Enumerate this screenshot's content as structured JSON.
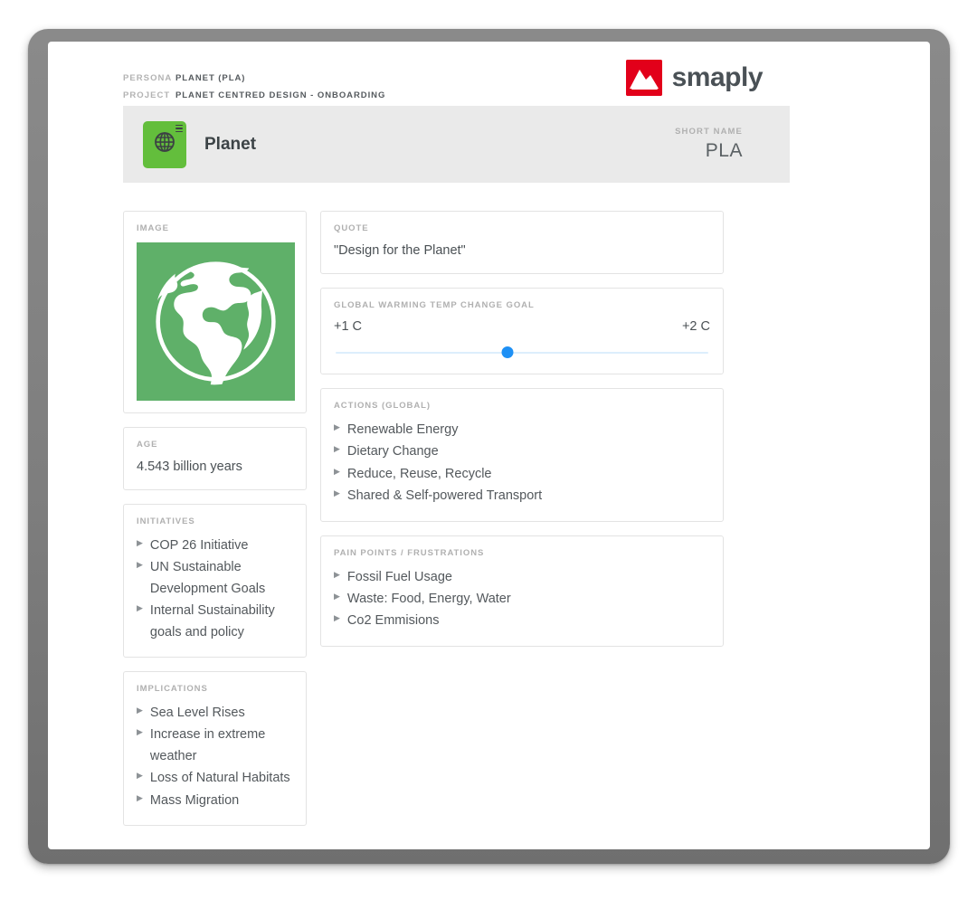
{
  "meta": {
    "persona_key": "PERSONA",
    "persona_value": "PLANET (PLA)",
    "project_key": "PROJECT",
    "project_value": "PLANET CENTRED DESIGN - ONBOARDING"
  },
  "brand": {
    "name": "smaply",
    "logo_color": "#e2001a",
    "text_color": "#4a5156"
  },
  "persona_header": {
    "name": "Planet",
    "avatar_icon": "globe-icon",
    "avatar_color": "#63be3c",
    "short_name_label": "SHORT NAME",
    "short_name_value": "PLA"
  },
  "left_column": {
    "image_card": {
      "label": "IMAGE",
      "image_alt": "earth-globe-illustration",
      "background_color": "#5fb069"
    },
    "age_card": {
      "label": "AGE",
      "value": "4.543 billion years"
    },
    "initiatives_card": {
      "label": "INITIATIVES",
      "items": [
        "COP 26 Initiative",
        "UN Sustainable Development Goals",
        "Internal Sustainability goals and policy"
      ]
    },
    "implications_card": {
      "label": "IMPLICATIONS",
      "items": [
        "Sea Level Rises",
        "Increase in extreme weather",
        "Loss of Natural Habitats",
        "Mass Migration"
      ]
    }
  },
  "right_column": {
    "quote_card": {
      "label": "QUOTE",
      "value": "\"Design for the Planet\""
    },
    "slider_card": {
      "label": "GLOBAL WARMING TEMP CHANGE GOAL",
      "min_label": "+1 C",
      "max_label": "+2 C",
      "value_percent": 46,
      "thumb_color": "#1e90f5",
      "track_color": "#ddeefc"
    },
    "actions_card": {
      "label": "ACTIONS (GLOBAL)",
      "items": [
        "Renewable Energy",
        "Dietary Change",
        "Reduce, Reuse, Recycle",
        "Shared & Self-powered  Transport"
      ]
    },
    "pain_points_card": {
      "label": "PAIN POINTS / FRUSTRATIONS",
      "items": [
        "Fossil Fuel Usage",
        "Waste: Food, Energy, Water",
        "Co2 Emmisions"
      ]
    }
  },
  "bullet_glyph": "▶"
}
